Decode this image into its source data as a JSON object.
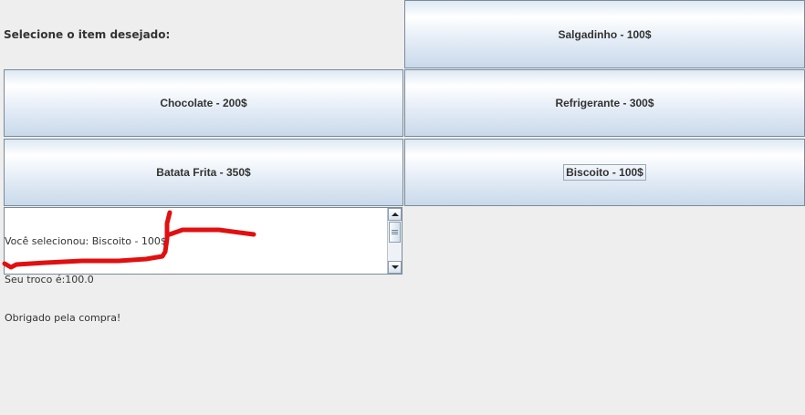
{
  "prompt_label": "Selecione o item desejado:",
  "items": {
    "salgadinho": "Salgadinho - 100$",
    "chocolate": "Chocolate - 200$",
    "refrigerante": "Refrigerante - 300$",
    "batata_frita": "Batata Frita - 350$",
    "biscoito": "Biscoito - 100$"
  },
  "focused_item": "biscoito",
  "output": {
    "lines": [
      "Você selecionou: Biscoito - 100$",
      "Seu troco é:100.0",
      "Obrigado pela compra!"
    ]
  },
  "icons": {
    "scroll_up": "triangle-up-icon",
    "scroll_down": "triangle-down-icon",
    "scroll_grip": "grip-lines-icon"
  },
  "colors": {
    "window_background": "#eeeeee",
    "button_border": "#7a8a99",
    "annotation": "#e01010"
  }
}
